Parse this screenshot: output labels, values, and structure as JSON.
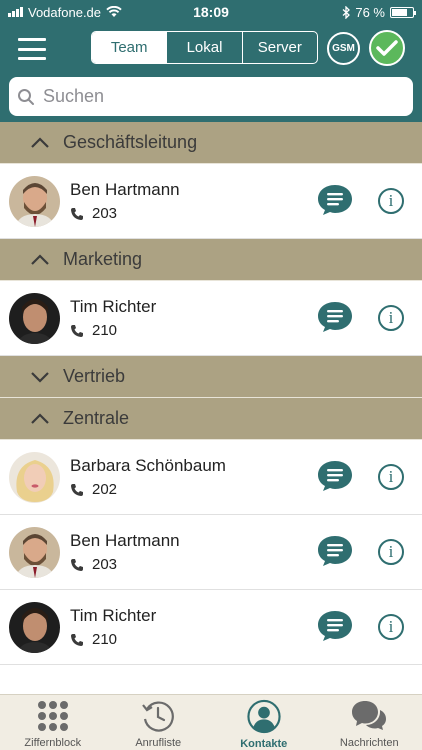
{
  "status_bar": {
    "carrier": "Vodafone.de",
    "time": "18:09",
    "battery": "76 %",
    "battery_level": 0.76
  },
  "nav": {
    "segments": [
      {
        "label": "Team",
        "active": true
      },
      {
        "label": "Lokal",
        "active": false
      },
      {
        "label": "Server",
        "active": false
      }
    ],
    "gsm_label": "GSM"
  },
  "search": {
    "placeholder": "Suchen",
    "value": ""
  },
  "groups": [
    {
      "name": "Geschäftsleitung",
      "expanded": true
    },
    {
      "name": "Marketing",
      "expanded": true
    },
    {
      "name": "Vertrieb",
      "expanded": false
    },
    {
      "name": "Zentrale",
      "expanded": true
    }
  ],
  "contacts": [
    {
      "name": "Ben Hartmann",
      "extension": "203"
    },
    {
      "name": "Tim Richter",
      "extension": "210"
    },
    {
      "name": "Barbara Schönbaum",
      "extension": "202"
    },
    {
      "name": "Ben Hartmann",
      "extension": "203"
    },
    {
      "name": "Tim Richter",
      "extension": "210"
    }
  ],
  "tabs": [
    {
      "label": "Ziffernblock",
      "icon": "keypad-icon",
      "active": false
    },
    {
      "label": "Anrufliste",
      "icon": "history-icon",
      "active": false
    },
    {
      "label": "Kontakte",
      "icon": "contacts-icon",
      "active": true
    },
    {
      "label": "Nachrichten",
      "icon": "messages-icon",
      "active": false
    }
  ],
  "colors": {
    "primary": "#2f6e70",
    "group_header": "#aca283",
    "confirm_green": "#5cb85c",
    "tab_bar": "#f1ede3"
  }
}
